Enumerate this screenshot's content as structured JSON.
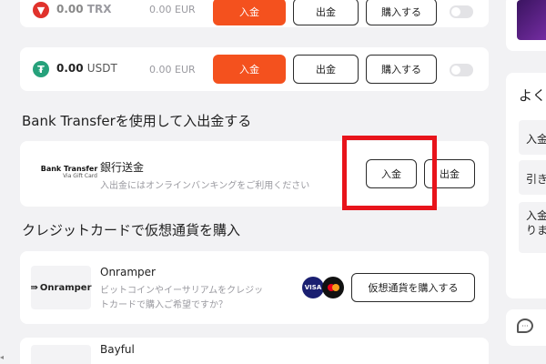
{
  "crypto_rows": [
    {
      "amount": "0.00",
      "symbol": "TRX",
      "fiat": "0.00 EUR",
      "icon_color": "#e0322c"
    },
    {
      "amount": "0.00",
      "symbol": "USDT",
      "fiat": "0.00 EUR",
      "icon_color": "#26a17b"
    }
  ],
  "row_buttons": {
    "deposit": "入金",
    "withdraw": "出金",
    "buy": "購入する"
  },
  "bank_section": {
    "title": "Bank Transferを使用して入出金する",
    "logo_main": "Bank Transfer",
    "logo_sub": "Via Gift Card",
    "name": "銀行送金",
    "desc": "入出金にはオンラインバンキングをご利用ください",
    "deposit": "入金",
    "withdraw": "出金"
  },
  "card_section": {
    "title": "クレジットカードで仮想通貨を購入",
    "provider": "Onramper",
    "logo": "Onramper",
    "desc_line1": "ビットコインやイーサリアムをクレジッ",
    "desc_line2": "トカードで購入ご希望ですか？",
    "visa": "VISA",
    "buy": "仮想通貨を購入する",
    "next_provider": "Bayful"
  },
  "sidebar": {
    "heading": "よく",
    "items": [
      "入金",
      "引き",
      "入金",
      "りま"
    ]
  },
  "colors": {
    "accent": "#f4511e",
    "highlight": "#e8141b",
    "purple": "#5b2d8c"
  }
}
